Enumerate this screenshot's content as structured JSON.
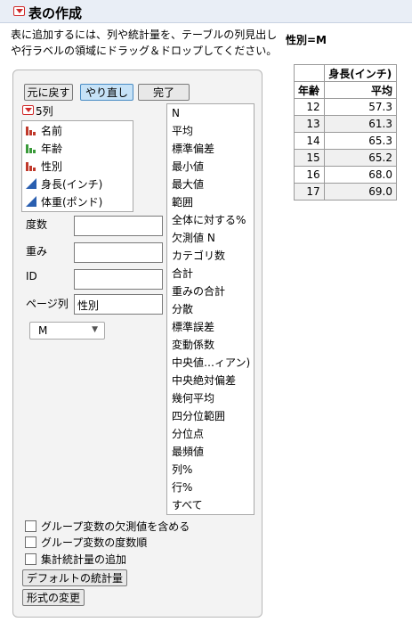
{
  "title": "表の作成",
  "instructions": "表に追加するには、列や統計量を、テーブルの列見出しや行ラベルの領域にドラッグ＆ドロップしてください。",
  "page_label": "性別=M",
  "toolbar": {
    "undo_label": "元に戻す",
    "redo_label": "やり直し",
    "done_label": "完了"
  },
  "columns": {
    "count_label": "5列",
    "items": [
      {
        "label": "名前",
        "icon": "nominal-icon"
      },
      {
        "label": "年齢",
        "icon": "ordinal-icon"
      },
      {
        "label": "性別",
        "icon": "nominal-icon"
      },
      {
        "label": "身長(インチ)",
        "icon": "continuous-icon"
      },
      {
        "label": "体重(ポンド)",
        "icon": "continuous-icon"
      }
    ]
  },
  "statistics": [
    "N",
    "平均",
    "標準偏差",
    "最小値",
    "最大値",
    "範囲",
    "全体に対する%",
    "欠測値 N",
    "カテゴリ数",
    "合計",
    "重みの合計",
    "分散",
    "標準誤差",
    "変動係数",
    "中央値…ィアン)",
    "中央絶対偏差",
    "幾何平均",
    "四分位範囲",
    "分位点",
    "最頻値",
    "列%",
    "行%",
    "すべて"
  ],
  "roles": {
    "freq_label": "度数",
    "freq_value": "",
    "weight_label": "重み",
    "weight_value": "",
    "id_label": "ID",
    "id_value": "",
    "page_label": "ページ列",
    "page_value": "性別"
  },
  "page_select": {
    "value": "M"
  },
  "options": {
    "include_missing": "グループ変数の欠測値を含める",
    "order_by_freq": "グループ変数の度数順",
    "add_aggregate": "集計統計量の追加"
  },
  "buttons": {
    "default_stats": "デフォルトの統計量",
    "change_format": "形式の変更"
  },
  "report": {
    "column_header": "身長(インチ)",
    "row_header": "年齢",
    "stat_header": "平均",
    "rows": [
      {
        "age": "12",
        "mean": "57.3"
      },
      {
        "age": "13",
        "mean": "61.3"
      },
      {
        "age": "14",
        "mean": "65.3"
      },
      {
        "age": "15",
        "mean": "65.2"
      },
      {
        "age": "16",
        "mean": "68.0"
      },
      {
        "age": "17",
        "mean": "69.0"
      }
    ]
  },
  "colors": {
    "nominal": "#c0392b",
    "ordinal": "#3a9a3a",
    "continuous": "#2a5fb0",
    "accent": "#d02a2a"
  }
}
